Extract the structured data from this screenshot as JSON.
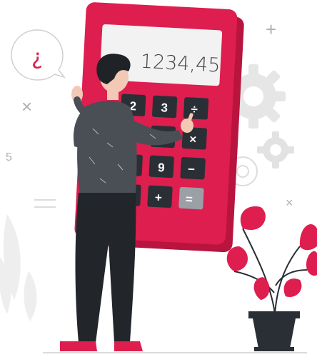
{
  "calculator": {
    "display": "1234,45",
    "keys": [
      "2",
      "3",
      "÷",
      "×",
      "9",
      "−",
      "+",
      "="
    ]
  },
  "speech_bubble": {
    "symbol": "¿"
  },
  "background_symbols": [
    "+",
    "×",
    "×",
    "5"
  ],
  "colors": {
    "accent": "#dd1e4f",
    "accent_dark": "#b8143e",
    "key": "#2a2f35",
    "shirt": "#4a4f55",
    "pants": "#22262b",
    "hair": "#1f2327",
    "skin": "#f2c9b4",
    "gear": "#e6e6e6",
    "line": "#c8c8c8"
  }
}
